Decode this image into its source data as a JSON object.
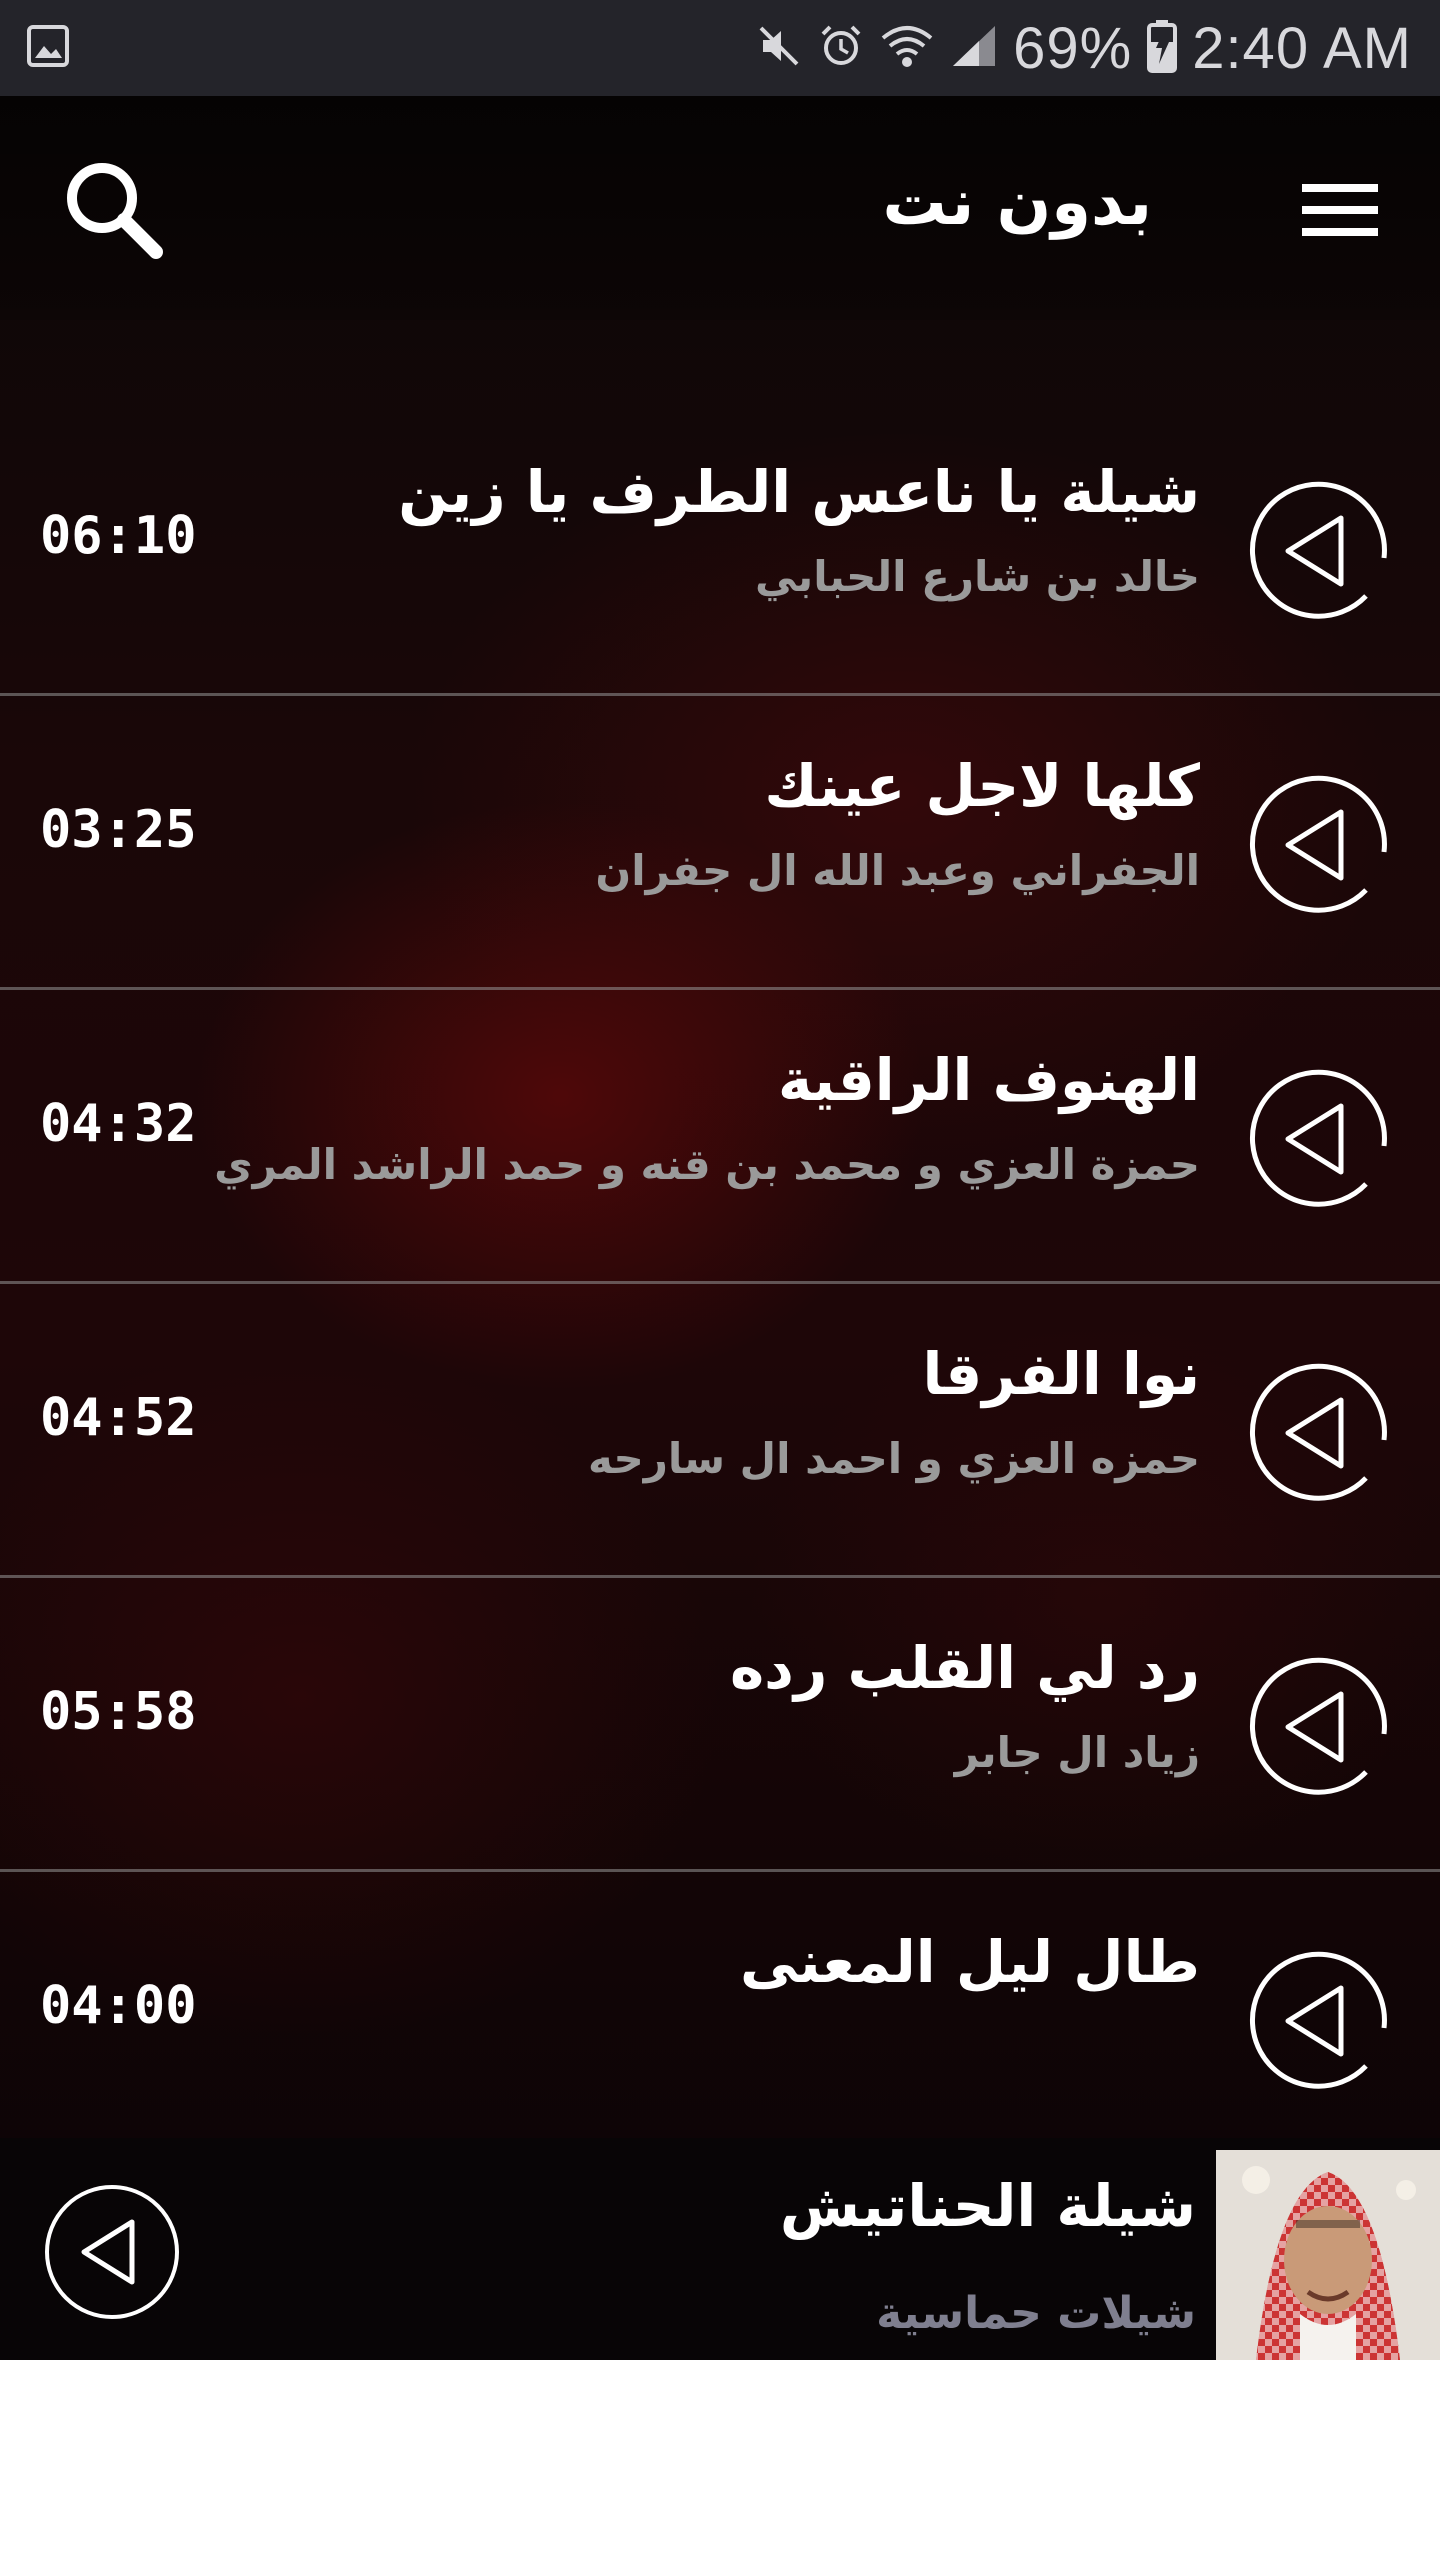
{
  "status_bar": {
    "battery": "69%",
    "time": "2:40 AM",
    "icons": [
      "image-notification-icon",
      "mute-icon",
      "alarm-icon",
      "wifi-icon",
      "signal-icon",
      "battery-charging-icon"
    ]
  },
  "header": {
    "title": "بدون نت",
    "search_icon": "search-icon",
    "menu_icon": "hamburger-menu-icon"
  },
  "tracks": [
    {
      "title": "شيلة يا ناعس الطرف يا زين",
      "artist": "خالد بن شارع الحبابي",
      "duration": "06:10"
    },
    {
      "title": "كلها لاجل عينك",
      "artist": "الجفراني وعبد الله ال جفران",
      "duration": "03:25"
    },
    {
      "title": "الهنوف الراقية",
      "artist": "حمزة العزي و محمد بن قنه و حمد الراشد المري",
      "duration": "04:32"
    },
    {
      "title": "نوا الفرقا",
      "artist": "حمزه العزي و احمد ال سارحه",
      "duration": "04:52"
    },
    {
      "title": "رد لي القلب رده",
      "artist": "زياد ال جابر",
      "duration": "05:58"
    },
    {
      "title": "طال ليل المعنى",
      "artist": "",
      "duration": "04:00"
    }
  ],
  "now_playing": {
    "title": "شيلة الحناتيش",
    "subtitle": "شيلات حماسية",
    "play_icon": "play-icon"
  },
  "colors": {
    "status_bar_bg": "#24242a",
    "app_bg_dark": "#0b0707",
    "app_bg_red": "#1e0608",
    "title_text": "#ffffff",
    "artist_text": "#9a9a9a",
    "divider": "#969696"
  }
}
